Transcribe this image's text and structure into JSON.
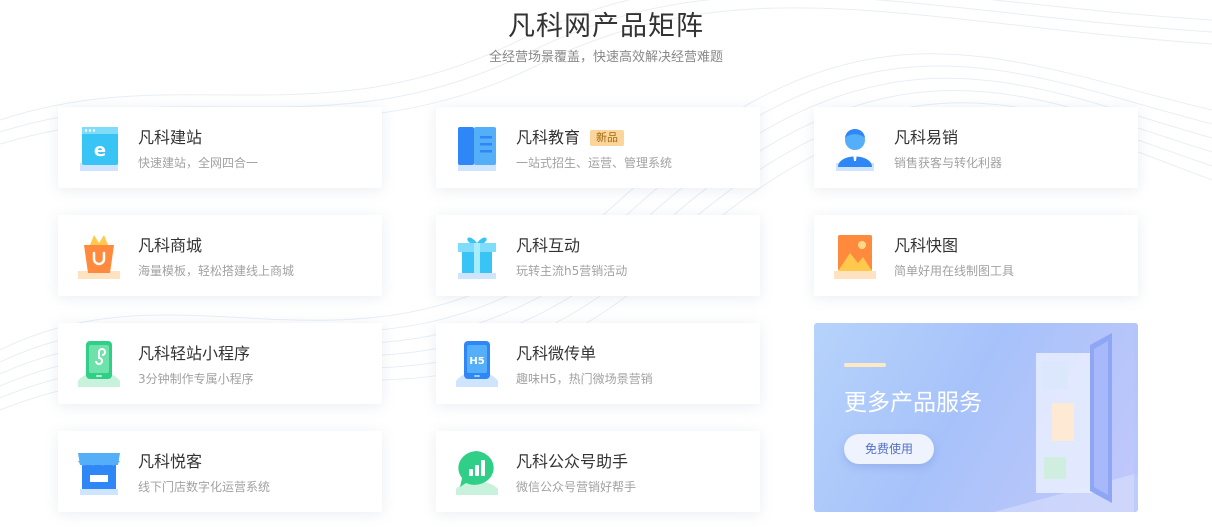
{
  "header": {
    "title": "凡科网产品矩阵",
    "subtitle": "全经营场景覆盖，快速高效解决经营难题"
  },
  "products": [
    {
      "name": "凡科建站",
      "desc": "快速建站，全网四合一",
      "icon": "website-icon"
    },
    {
      "name": "凡科教育",
      "desc": "一站式招生、运营、管理系统",
      "badge": "新品",
      "icon": "education-book-icon"
    },
    {
      "name": "凡科易销",
      "desc": "销售获客与转化利器",
      "icon": "salesperson-icon"
    },
    {
      "name": "凡科商城",
      "desc": "海量模板，轻松搭建线上商城",
      "icon": "shopping-bag-icon"
    },
    {
      "name": "凡科互动",
      "desc": "玩转主流h5营销活动",
      "icon": "gift-box-icon"
    },
    {
      "name": "凡科快图",
      "desc": "简单好用在线制图工具",
      "icon": "picture-icon"
    },
    {
      "name": "凡科轻站小程序",
      "desc": "3分钟制作专属小程序",
      "icon": "mini-program-phone-icon"
    },
    {
      "name": "凡科微传单",
      "desc": "趣味H5，热门微场景营销",
      "icon": "h5-phone-icon",
      "icon_text": "H5"
    },
    {
      "name": "凡科悦客",
      "desc": "线下门店数字化运营系统",
      "icon": "storefront-icon"
    },
    {
      "name": "凡科公众号助手",
      "desc": "微信公众号营销好帮手",
      "icon": "chat-chart-icon"
    }
  ],
  "promo": {
    "title": "更多产品服务",
    "button": "免费使用"
  },
  "colors": {
    "accent_blue": "#2f86f6",
    "icon_bg_blue": "#cfe4ff",
    "icon_bg_orange": "#ffe2bf",
    "icon_bg_green": "#c9f2dc",
    "badge_bg": "#fcd59a"
  }
}
